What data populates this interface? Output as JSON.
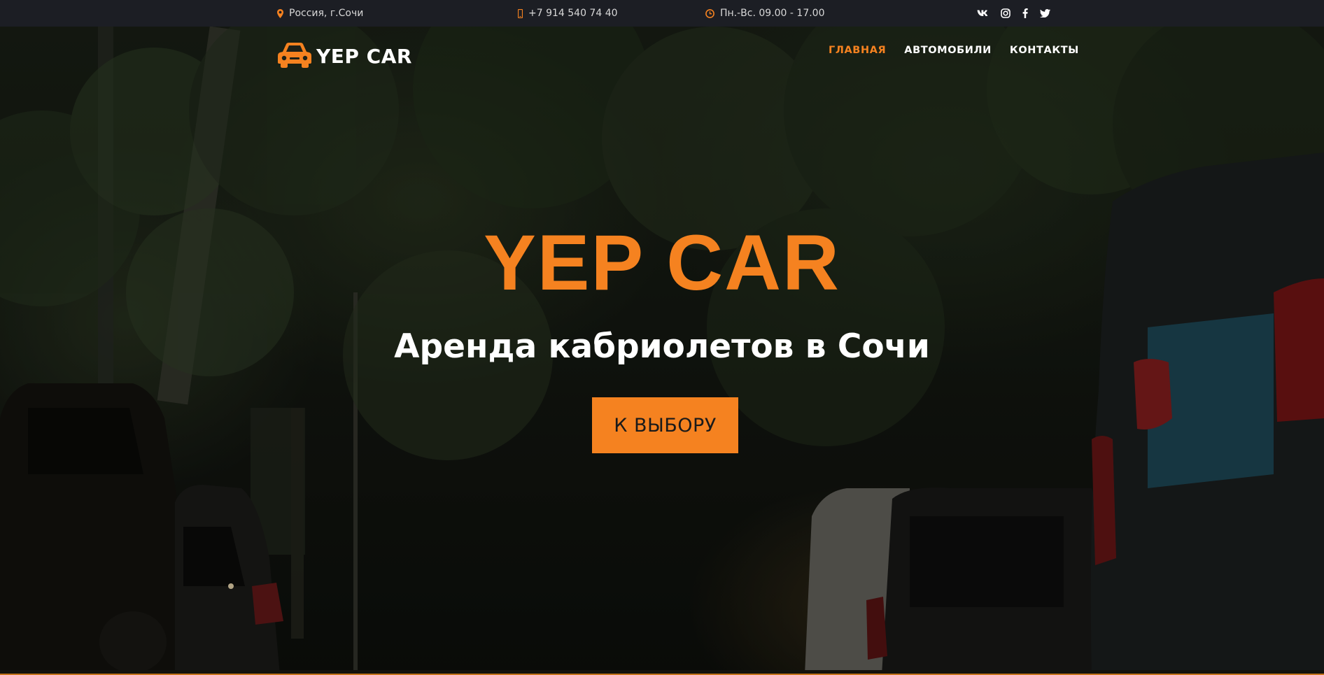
{
  "topbar": {
    "location": {
      "icon": "map-marker-icon",
      "text": "Россия, г.Сочи"
    },
    "phone": {
      "icon": "mobile-phone-icon",
      "text": "+7 914 540 74 40"
    },
    "hours": {
      "icon": "clock-icon",
      "text": "Пн.-Вс. 09.00 - 17.00"
    },
    "social": [
      "vk-icon",
      "instagram-icon",
      "facebook-icon",
      "twitter-icon"
    ]
  },
  "header": {
    "logo_text": "YEP CAR",
    "nav": [
      {
        "label": "ГЛАВНАЯ",
        "active": true
      },
      {
        "label": "АВТОМОБИЛИ",
        "active": false
      },
      {
        "label": "КОНТАКТЫ",
        "active": false
      }
    ]
  },
  "hero": {
    "title": "YEP CAR",
    "subtitle": "Аренда кабриолетов в Сочи",
    "button_label": "К ВЫБОРУ"
  },
  "colors": {
    "accent": "#f58220",
    "topbar_bg": "#1c1e24",
    "text_light": "#ffffff"
  }
}
